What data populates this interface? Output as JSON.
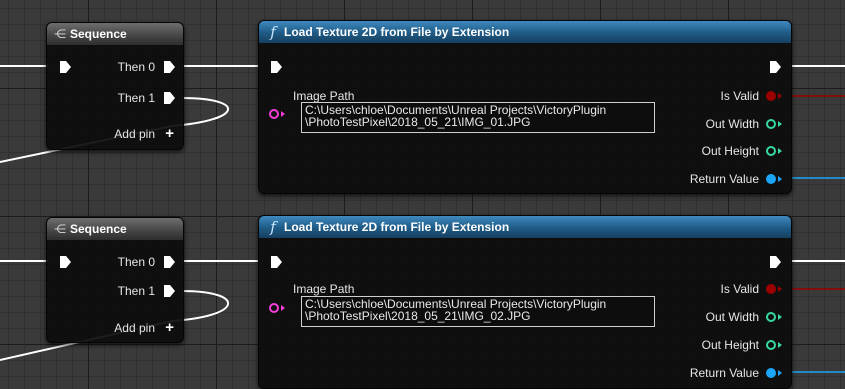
{
  "nodes": [
    {
      "sequence": {
        "title": "Sequence",
        "then0": "Then 0",
        "then1": "Then 1",
        "add_pin": "Add pin"
      },
      "load": {
        "title": "Load Texture 2D from File by Extension",
        "image_path_label": "Image Path",
        "image_path_value": "C:\\Users\\chloe\\Documents\\Unreal Projects\\VictoryPlugin\n\\PhotoTestPixel\\2018_05_21\\IMG_01.JPG",
        "is_valid": "Is Valid",
        "out_width": "Out Width",
        "out_height": "Out Height",
        "return_value": "Return Value"
      }
    },
    {
      "sequence": {
        "title": "Sequence",
        "then0": "Then 0",
        "then1": "Then 1",
        "add_pin": "Add pin"
      },
      "load": {
        "title": "Load Texture 2D from File by Extension",
        "image_path_label": "Image Path",
        "image_path_value": "C:\\Users\\chloe\\Documents\\Unreal Projects\\VictoryPlugin\n\\PhotoTestPixel\\2018_05_21\\IMG_02.JPG",
        "is_valid": "Is Valid",
        "out_width": "Out Width",
        "out_height": "Out Height",
        "return_value": "Return Value"
      }
    }
  ],
  "colors": {
    "exec": "#ffffff",
    "bool": "#9c0000",
    "int": "#36d9a0",
    "object": "#1aa6f5",
    "string": "#f13fd7",
    "function_header": "#1f5a85",
    "sequence_header": "#444444"
  },
  "icons": {
    "sequence_icon": "sequence-icon",
    "function_icon": "function-icon"
  }
}
